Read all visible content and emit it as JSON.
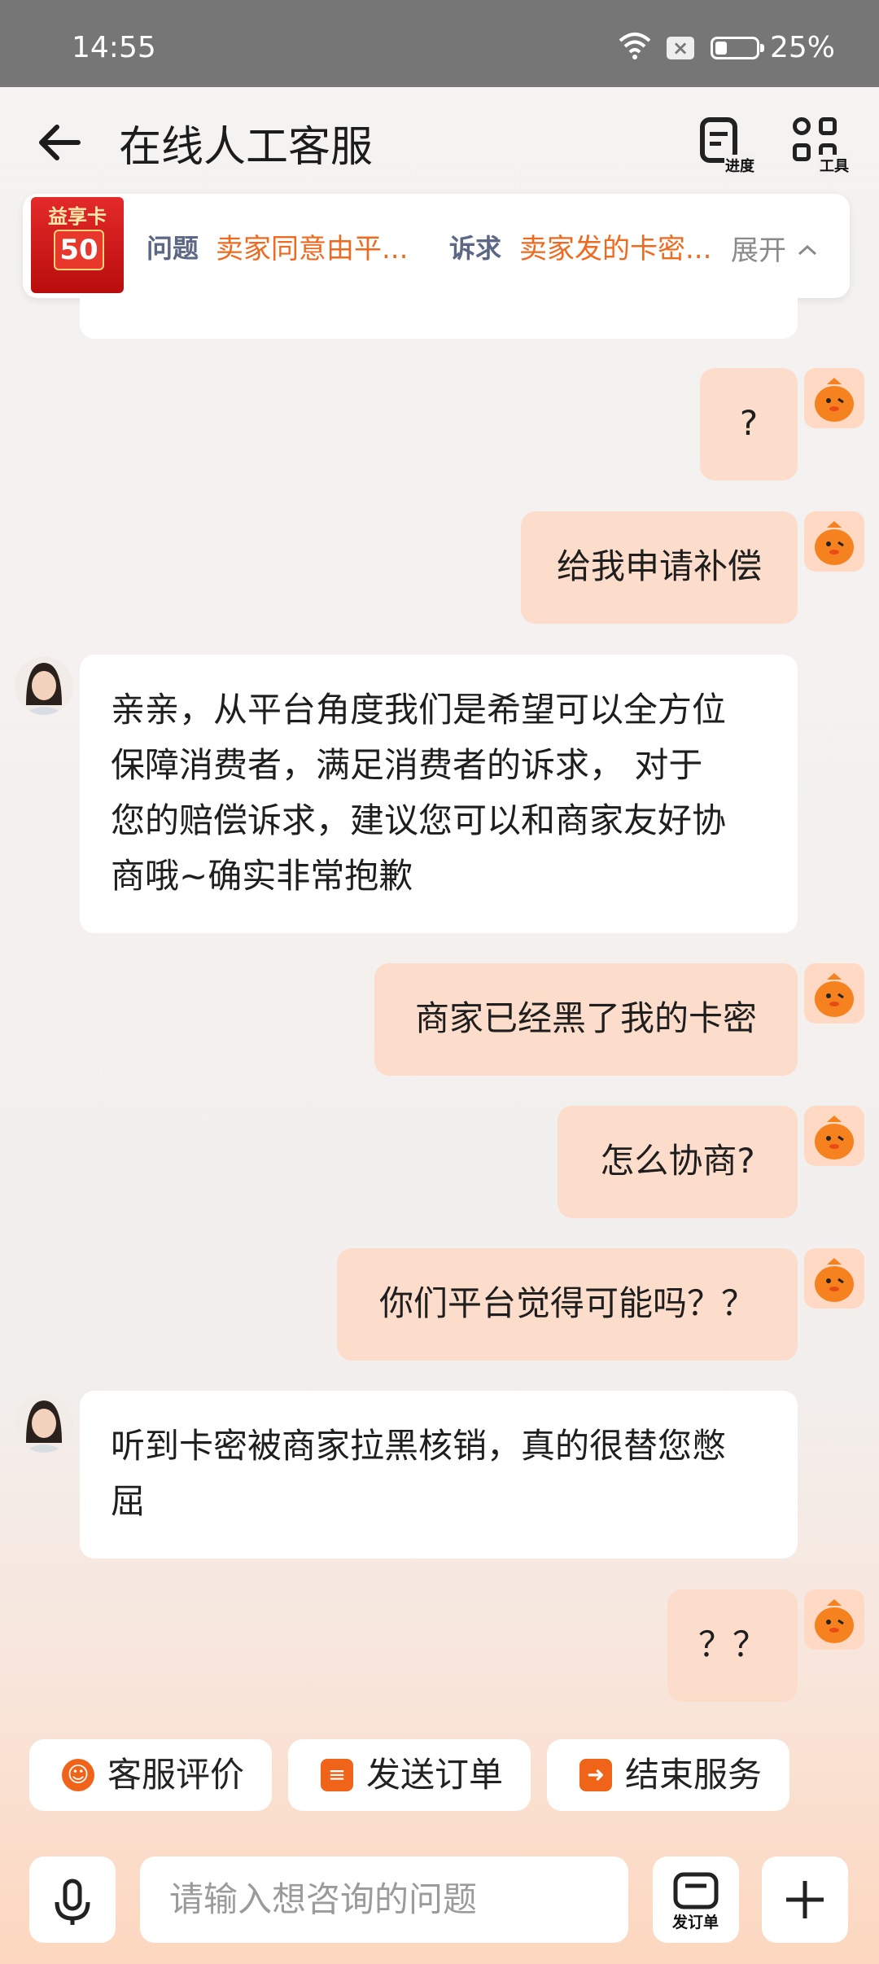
{
  "status_bar": {
    "time": "14:55",
    "battery": "25%"
  },
  "header": {
    "title": "在线人工客服",
    "progress_label": "进度",
    "tools_label": "工具"
  },
  "issue_bar": {
    "card_title": "益享卡",
    "card_value": "50",
    "issue_label": "问题",
    "issue_value": "卖家同意由平...",
    "claim_label": "诉求",
    "claim_value": "卖家发的卡密...",
    "expand_label": "展开"
  },
  "messages": [
    {
      "from": "me",
      "text": "?"
    },
    {
      "from": "me",
      "text": "给我申请补偿"
    },
    {
      "from": "agent",
      "lines": [
        "亲亲，从平台角度我们是希望可以全方位",
        "保障消费者，满足消费者的诉求， 对于",
        "您的赔偿诉求，建议您可以和商家友好协",
        "商哦~确实非常抱歉"
      ]
    },
    {
      "from": "me",
      "text": "商家已经黑了我的卡密"
    },
    {
      "from": "me",
      "text": "怎么协商?"
    },
    {
      "from": "me",
      "text": "你们平台觉得可能吗？？"
    },
    {
      "from": "agent",
      "lines": [
        "听到卡密被商家拉黑核销，真的很替您憋",
        "屈"
      ]
    },
    {
      "from": "me",
      "text": "？？"
    }
  ],
  "quick_actions": [
    {
      "label": "客服评价",
      "icon": "smile-icon"
    },
    {
      "label": "发送订单",
      "icon": "clipboard-icon"
    },
    {
      "label": "结束服务",
      "icon": "exit-icon"
    }
  ],
  "input_bar": {
    "placeholder": "请输入想咨询的问题",
    "order_label": "发订单"
  }
}
